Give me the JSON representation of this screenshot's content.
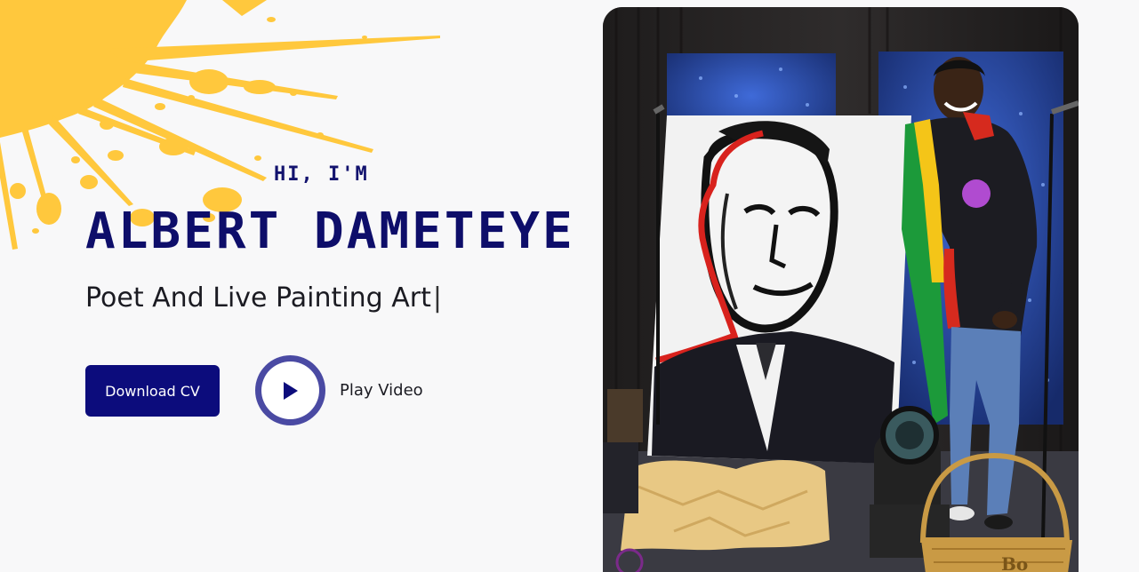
{
  "hero": {
    "greeting": "HI, I'M",
    "name": "ALBERT DAMETEYE",
    "tagline": "Poet And Live Painting Art",
    "cursor": "|"
  },
  "actions": {
    "download_label": "Download CV",
    "play_label": "Play Video"
  },
  "colors": {
    "accent": "#0c0c7c",
    "splash": "#ffc83d",
    "play_ring": "#4a4aa3"
  },
  "photo": {
    "sign_text": "Bo"
  }
}
